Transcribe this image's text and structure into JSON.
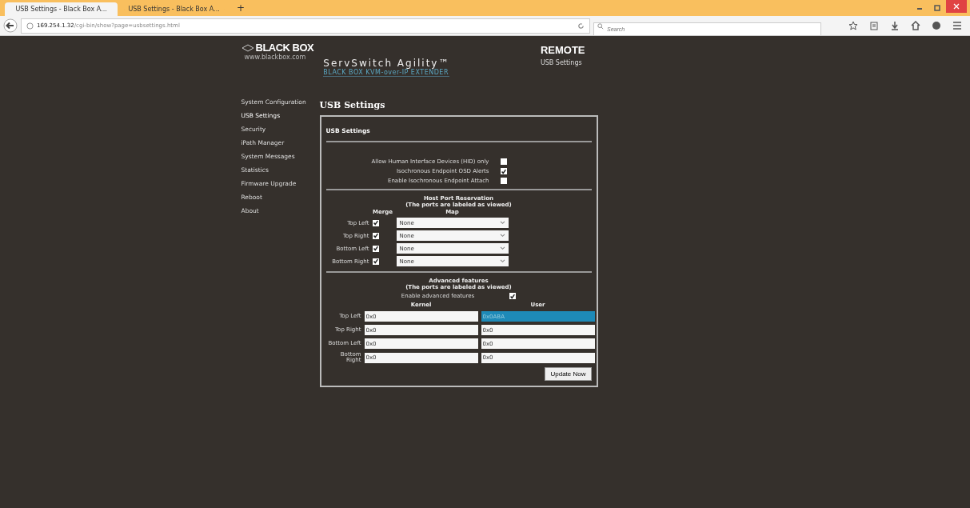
{
  "browser": {
    "tabs": [
      {
        "title": "USB Settings - Black Box A...",
        "selected": true
      },
      {
        "title": "USB Settings - Black Box A...",
        "selected": false
      }
    ],
    "new_tab": "+",
    "address": {
      "host": "169.254.1.32",
      "path": "/cgi-bin/show?page=usbsettings.html"
    },
    "search": {
      "placeholder": "Search"
    }
  },
  "header": {
    "brand": "BLACK BOX",
    "brand_url": "www.blackbox.com",
    "product": "ServSwitch Agility™",
    "tagline": "BLACK BOX KVM-over-IP EXTENDER",
    "mode": "REMOTE",
    "page": "USB Settings"
  },
  "sidebar": {
    "items": [
      {
        "label": "System Configuration",
        "selected": false
      },
      {
        "label": "USB Settings",
        "selected": true
      },
      {
        "label": "Security",
        "selected": false
      },
      {
        "label": "iPath Manager",
        "selected": false
      },
      {
        "label": "System Messages",
        "selected": false
      },
      {
        "label": "Statistics",
        "selected": false
      },
      {
        "label": "Firmware Upgrade",
        "selected": false
      },
      {
        "label": "Reboot",
        "selected": false
      },
      {
        "label": "About",
        "selected": false
      }
    ]
  },
  "main": {
    "title": "USB Settings",
    "panel_title": "USB Settings",
    "options": [
      {
        "label": "Allow Human Interface Devices (HID) only",
        "checked": false
      },
      {
        "label": "Isochronous Endpoint OSD Alerts",
        "checked": true
      },
      {
        "label": "Enable Isochronous Endpoint Attach",
        "checked": false
      }
    ],
    "reservation": {
      "title": "Host Port Reservation",
      "subtitle": "(The ports are labeled as viewed)",
      "merge_header": "Merge",
      "map_header": "Map",
      "ports": [
        {
          "label": "Top Left",
          "merge": true,
          "map": "None"
        },
        {
          "label": "Top Right",
          "merge": true,
          "map": "None"
        },
        {
          "label": "Bottom Left",
          "merge": true,
          "map": "None"
        },
        {
          "label": "Bottom Right",
          "merge": true,
          "map": "None"
        }
      ]
    },
    "advanced": {
      "title": "Advanced features",
      "subtitle": "(The ports are labeled as viewed)",
      "enable_label": "Enable advanced features",
      "enabled": true,
      "kernel_header": "Kernel",
      "user_header": "User",
      "ports": [
        {
          "label": "Top Left",
          "kernel": "0x0",
          "user": "0x0ABA",
          "user_selected": true
        },
        {
          "label": "Top Right",
          "kernel": "0x0",
          "user": "0x0",
          "user_selected": false
        },
        {
          "label": "Bottom Left",
          "kernel": "0x0",
          "user": "0x0",
          "user_selected": false
        },
        {
          "label": "Bottom Right",
          "kernel": "0x0",
          "user": "0x0",
          "user_selected": false
        }
      ]
    },
    "button": "Update Now"
  }
}
